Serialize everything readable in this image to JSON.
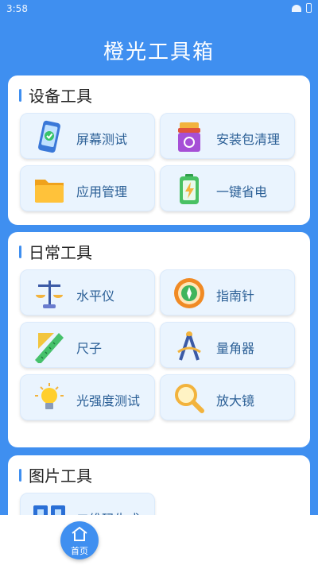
{
  "status_bar": {
    "time": "3:58"
  },
  "app": {
    "title": "橙光工具箱"
  },
  "sections": [
    {
      "title": "设备工具",
      "tools": [
        {
          "label": "屏幕测试",
          "icon": "phone-check-icon"
        },
        {
          "label": "安装包清理",
          "icon": "recycle-box-icon"
        },
        {
          "label": "应用管理",
          "icon": "folder-icon"
        },
        {
          "label": "一键省电",
          "icon": "battery-icon"
        }
      ]
    },
    {
      "title": "日常工具",
      "tools": [
        {
          "label": "水平仪",
          "icon": "balance-scale-icon"
        },
        {
          "label": "指南针",
          "icon": "compass-icon"
        },
        {
          "label": "尺子",
          "icon": "ruler-icon"
        },
        {
          "label": "量角器",
          "icon": "divider-compass-icon"
        },
        {
          "label": "光强度测试",
          "icon": "light-bulb-icon"
        },
        {
          "label": "放大镜",
          "icon": "magnifier-icon"
        }
      ]
    },
    {
      "title": "图片工具",
      "tools": [
        {
          "label": "二维码生成",
          "icon": "qr-code-icon"
        }
      ]
    }
  ],
  "bottom_nav": {
    "home_label": "首页"
  },
  "colors": {
    "primary": "#3f8ff0",
    "card_bg": "#eaf4fe",
    "label": "#2b5f96"
  }
}
